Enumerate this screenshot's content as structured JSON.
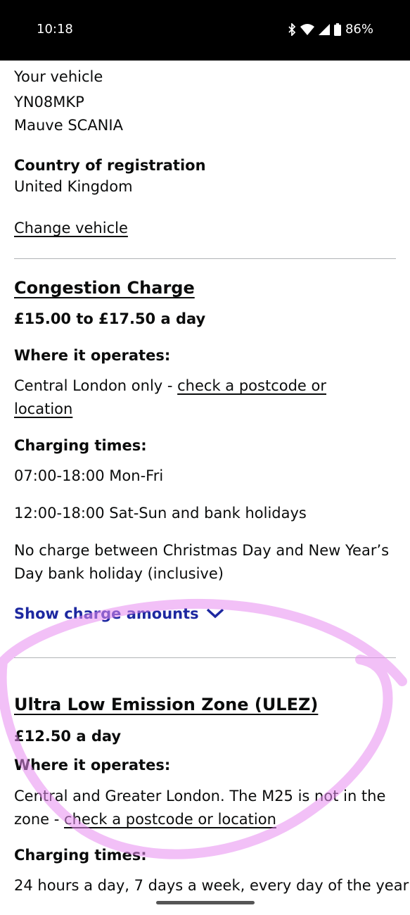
{
  "status_bar": {
    "time": "10:18",
    "battery": "86%",
    "icons": [
      "bluetooth-icon",
      "wifi-icon",
      "signal-icon",
      "battery-icon"
    ]
  },
  "vehicle": {
    "heading": "Your vehicle",
    "registration": "YN08MKP",
    "description": "Mauve SCANIA",
    "country_label": "Country of registration",
    "country_value": "United Kingdom",
    "change_link": "Change vehicle"
  },
  "congestion": {
    "title": "Congestion Charge",
    "price": "£15.00 to £17.50 a day",
    "where_label": "Where it operates:",
    "where_text": "Central London only - ",
    "where_link_1": "check a postcode or",
    "where_link_2": "location",
    "times_label": "Charging times:",
    "times_1": "07:00-18:00 Mon-Fri",
    "times_2": "12:00-18:00 Sat-Sun and bank holidays",
    "note_1": "No charge between Christmas Day and New Year’s",
    "note_2": "Day bank holiday (inclusive)",
    "show_amounts": "Show charge amounts"
  },
  "ulez": {
    "title": "Ultra Low Emission Zone (ULEZ)",
    "price": "£12.50 a day",
    "where_label": "Where it operates:",
    "where_text_1": "Central and Greater London. The M25 is not in the",
    "where_text_2": "zone - ",
    "where_link": "check a postcode or location",
    "times_label": "Charging times:",
    "times_1": "24 hours a day, 7 days a week, every day of the year"
  },
  "colors": {
    "link_blue": "#1d28a0",
    "annotation_pink": "#e88cf0",
    "divider": "#b1b4b6"
  }
}
